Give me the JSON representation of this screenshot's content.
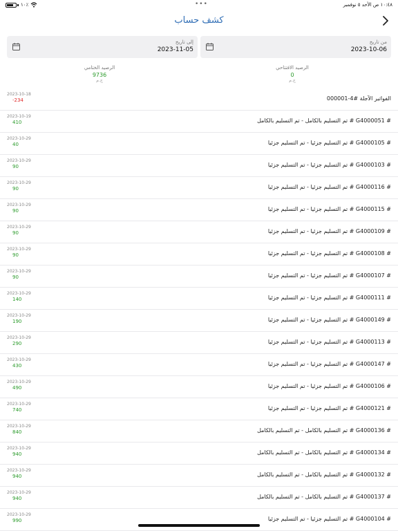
{
  "status_bar": {
    "time": "١٠:٤٨ ص   الأحد ٥ نوفمبر",
    "battery": "١٠٪"
  },
  "nav": {
    "title": "كشف حساب"
  },
  "dates": {
    "from_label": "من تاريخ",
    "from_value": "2023-10-06",
    "to_label": "إلى تاريخ",
    "to_value": "2023-11-05"
  },
  "balances": {
    "opening_label": "الرصيد الافتتاحي",
    "opening_value": "0",
    "closing_label": "الرصيد الختامي",
    "closing_value": "9736",
    "currency": "ج.م"
  },
  "colors": {
    "accent": "#2f6db5",
    "positive": "#2a9a2a",
    "negative": "#e02a2a"
  },
  "rows": [
    {
      "title": "الفواتير الآجلة #4-000001",
      "date": "2023-10-18",
      "amount": "-234",
      "sign": "neg"
    },
    {
      "title": "# G4000051 # تم التسليم بالكامل - تم التسليم بالكامل",
      "date": "2023-10-19",
      "amount": "410",
      "sign": "pos"
    },
    {
      "title": "# G4000105 # تم التسليم جزئيا - تم التسليم جزئيا",
      "date": "2023-10-29",
      "amount": "40",
      "sign": "pos"
    },
    {
      "title": "# G4000103 # تم التسليم جزئيا - تم التسليم جزئيا",
      "date": "2023-10-29",
      "amount": "90",
      "sign": "pos"
    },
    {
      "title": "# G4000116 # تم التسليم جزئيا - تم التسليم جزئيا",
      "date": "2023-10-29",
      "amount": "90",
      "sign": "pos"
    },
    {
      "title": "# G4000115 # تم التسليم جزئيا - تم التسليم جزئيا",
      "date": "2023-10-29",
      "amount": "90",
      "sign": "pos"
    },
    {
      "title": "# G4000109 # تم التسليم جزئيا - تم التسليم جزئيا",
      "date": "2023-10-29",
      "amount": "90",
      "sign": "pos"
    },
    {
      "title": "# G4000108 # تم التسليم جزئيا - تم التسليم جزئيا",
      "date": "2023-10-29",
      "amount": "90",
      "sign": "pos"
    },
    {
      "title": "# G4000107 # تم التسليم جزئيا - تم التسليم جزئيا",
      "date": "2023-10-29",
      "amount": "90",
      "sign": "pos"
    },
    {
      "title": "# G4000111 # تم التسليم جزئيا - تم التسليم جزئيا",
      "date": "2023-10-29",
      "amount": "140",
      "sign": "pos"
    },
    {
      "title": "# G4000149 # تم التسليم جزئيا - تم التسليم جزئيا",
      "date": "2023-10-29",
      "amount": "190",
      "sign": "pos"
    },
    {
      "title": "# G4000113 # تم التسليم جزئيا - تم التسليم جزئيا",
      "date": "2023-10-29",
      "amount": "290",
      "sign": "pos"
    },
    {
      "title": "# G4000147 # تم التسليم جزئيا - تم التسليم جزئيا",
      "date": "2023-10-29",
      "amount": "430",
      "sign": "pos"
    },
    {
      "title": "# G4000106 # تم التسليم جزئيا - تم التسليم جزئيا",
      "date": "2023-10-29",
      "amount": "490",
      "sign": "pos"
    },
    {
      "title": "# G4000121 # تم التسليم جزئيا - تم التسليم جزئيا",
      "date": "2023-10-29",
      "amount": "740",
      "sign": "pos"
    },
    {
      "title": "# G4000136 # تم التسليم بالكامل - تم التسليم بالكامل",
      "date": "2023-10-29",
      "amount": "840",
      "sign": "pos"
    },
    {
      "title": "# G4000134 # تم التسليم بالكامل - تم التسليم بالكامل",
      "date": "2023-10-29",
      "amount": "940",
      "sign": "pos"
    },
    {
      "title": "# G4000132 # تم التسليم بالكامل - تم التسليم بالكامل",
      "date": "2023-10-29",
      "amount": "940",
      "sign": "pos"
    },
    {
      "title": "# G4000137 # تم التسليم بالكامل - تم التسليم بالكامل",
      "date": "2023-10-29",
      "amount": "940",
      "sign": "pos"
    },
    {
      "title": "# G4000104 # تم التسليم جزئيا - تم التسليم جزئيا",
      "date": "2023-10-29",
      "amount": "990",
      "sign": "pos"
    }
  ]
}
